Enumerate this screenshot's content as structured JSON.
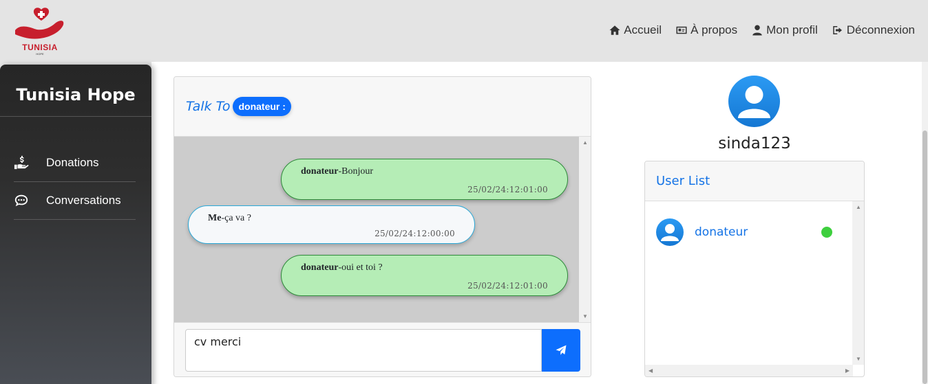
{
  "brand": {
    "logo_text": "TUNISIA",
    "logo_sub": "HOPE",
    "colors": {
      "logo_red": "#c71f2d"
    }
  },
  "nav": [
    {
      "label": "Accueil",
      "icon": "home-icon"
    },
    {
      "label": "À propos",
      "icon": "id-card-icon"
    },
    {
      "label": "Mon profil",
      "icon": "user-icon"
    },
    {
      "label": "Déconnexion",
      "icon": "sign-out-icon"
    }
  ],
  "sidebar": {
    "title": "Tunisia Hope",
    "items": [
      {
        "label": "Donations",
        "icon": "hand-donation-icon"
      },
      {
        "label": "Conversations",
        "icon": "chat-bubble-icon"
      }
    ]
  },
  "chat": {
    "talk_to_label": "Talk To",
    "recipient_badge": "donateur :",
    "messages": [
      {
        "sender": "donateur",
        "text": "-Bonjour",
        "time": "25/02/24:12:01:00",
        "side": "them"
      },
      {
        "sender": "Me",
        "text": "-ça va ?",
        "time": "25/02/24:12:00:00",
        "side": "me"
      },
      {
        "sender": "donateur",
        "text": "-oui et toi ?",
        "time": "25/02/24:12:01:00",
        "side": "them"
      }
    ],
    "input_value": "cv merci",
    "send_icon": "paper-plane-icon",
    "colors": {
      "them_bubble": "#b5edb6",
      "me_bubble": "#f6f8fa",
      "accent": "#0d6efd"
    }
  },
  "profile": {
    "username": "sinda123"
  },
  "user_list": {
    "title": "User List",
    "users": [
      {
        "name": "donateur",
        "online": true
      }
    ],
    "colors": {
      "online": "#3ecf3e"
    }
  }
}
